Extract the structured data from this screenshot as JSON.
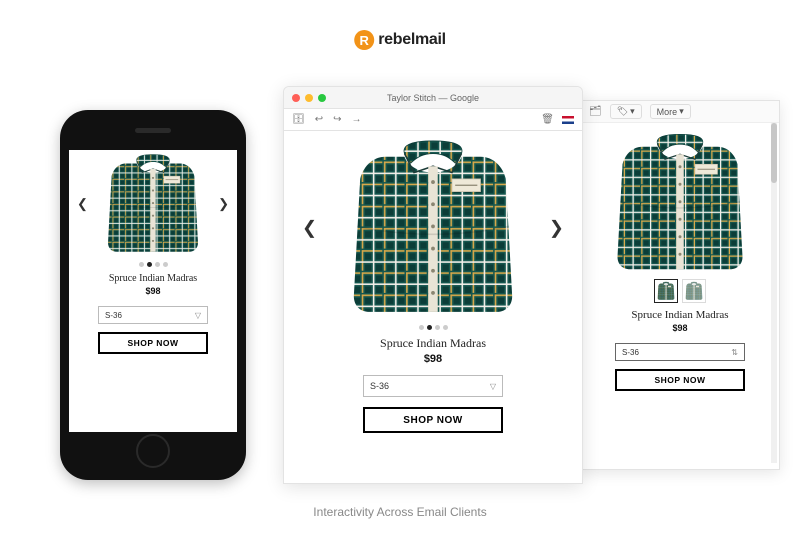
{
  "brand": {
    "mark_letter": "R",
    "name": "rebelmail"
  },
  "mac_window": {
    "title": "Taylor Stitch — Google"
  },
  "alt_window": {
    "more_label": "More",
    "tag_caret": "▾"
  },
  "product": {
    "name": "Spruce Indian Madras",
    "price": "$98",
    "size_option": "S-36",
    "cta": "SHOP NOW"
  },
  "caption": "Interactivity Across Email Clients"
}
